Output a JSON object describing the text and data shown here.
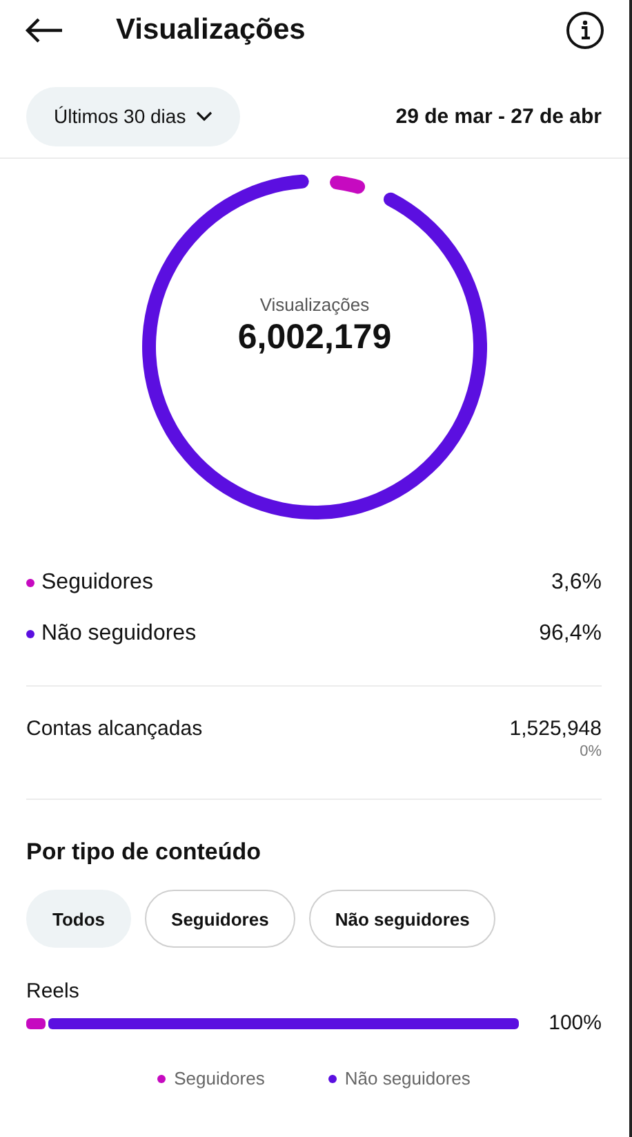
{
  "header": {
    "title": "Visualizações"
  },
  "period": {
    "dropdown": "Últimos 30 dias",
    "range": "29 de mar - 27 de abr"
  },
  "summary": {
    "label": "Visualizações",
    "total": "6,002,179",
    "chart_data": {
      "type": "donut",
      "categories": [
        "Seguidores",
        "Não seguidores"
      ],
      "values": [
        3.6,
        96.4
      ]
    }
  },
  "legend": [
    {
      "value": "3,6%",
      "color": "#c60ac0"
    },
    {
      "value": "96,4%",
      "color": "#5b0fe0"
    }
  ],
  "reach": {
    "label": "Contas alcançadas",
    "value": "1,525,948",
    "change": "0%"
  },
  "content_type": {
    "heading": "Por tipo de conteúdo",
    "filters": [
      {
        "label": "Todos",
        "selected": true
      },
      {
        "label": "Seguidores",
        "selected": false
      },
      {
        "label": "Não seguidores",
        "selected": false
      }
    ],
    "rows": [
      {
        "label": "Reels",
        "level": 0.04,
        "value": "100%"
      }
    ],
    "legend": [
      {
        "label": "Seguidores",
        "color": "#c60ac0"
      },
      {
        "label": "Não seguidores",
        "color": "#5b0fe0"
      }
    ]
  }
}
